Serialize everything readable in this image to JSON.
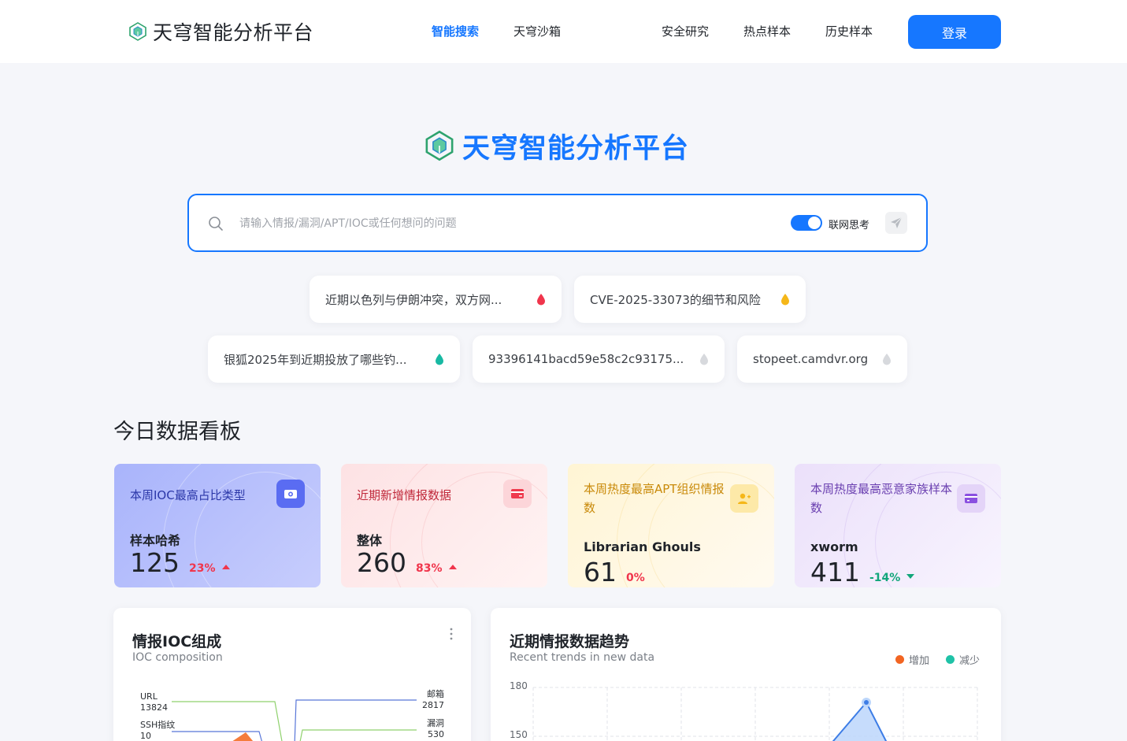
{
  "header": {
    "brand": "天穹智能分析平台",
    "nav": [
      {
        "label": "智能搜索",
        "active": true
      },
      {
        "label": "天穹沙箱",
        "active": false
      },
      {
        "label": "安全研究",
        "active": false
      },
      {
        "label": "热点样本",
        "active": false
      },
      {
        "label": "历史样本",
        "active": false
      }
    ],
    "login_label": "登录"
  },
  "hero": {
    "title": "天穹智能分析平台"
  },
  "search": {
    "placeholder": "请输入情报/漏洞/APT/IOC或任何想问的问题",
    "value": "",
    "toggle_label": "联网思考",
    "toggle_on": true
  },
  "suggestions": [
    {
      "text": "近期以色列与伊朗冲突，双方网...",
      "icon": "drop-icon",
      "color": "#f0354c"
    },
    {
      "text": "CVE-2025-33073的细节和风险",
      "icon": "drop-icon",
      "color": "#f5b719"
    },
    {
      "text": "银狐2025年到近期投放了哪些钓...",
      "icon": "drop-icon",
      "color": "#18b9a3"
    },
    {
      "text": "93396141bacd59e58c2c93175...",
      "icon": "drop-icon",
      "color": "#d7d9dd"
    },
    {
      "text": "stopeet.camdvr.org",
      "icon": "drop-icon",
      "color": "#d7d9dd"
    }
  ],
  "dashboard": {
    "title": "今日数据看板",
    "cards": [
      {
        "title": "本周IOC最高占比类型",
        "sub": "样本哈希",
        "value": "125",
        "delta": "23%",
        "trend": "up",
        "icon": "camera-icon"
      },
      {
        "title": "近期新增情报数据",
        "sub": "整体",
        "value": "260",
        "delta": "83%",
        "trend": "up",
        "icon": "card-icon"
      },
      {
        "title": "本周热度最高APT组织情报数",
        "sub": "Librarian Ghouls",
        "value": "61",
        "delta": "0%",
        "trend": "none",
        "icon": "user-add-icon"
      },
      {
        "title": "本周热度最高恶意家族样本数",
        "sub": "xworm",
        "value": "411",
        "delta": "-14%",
        "trend": "down",
        "icon": "wallet-icon"
      }
    ]
  },
  "ioc_panel": {
    "title": "情报IOC组成",
    "subtitle": "IOC composition",
    "left_labels": [
      {
        "name": "URL",
        "value": "13824"
      },
      {
        "name": "SSH指纹",
        "value": "10"
      }
    ],
    "right_labels": [
      {
        "name": "邮箱",
        "value": "2817"
      },
      {
        "name": "漏洞",
        "value": "530"
      }
    ]
  },
  "trend_panel": {
    "title": "近期情报数据趋势",
    "subtitle": "Recent trends in new data",
    "legend": [
      {
        "label": "增加",
        "color": "#f26522"
      },
      {
        "label": "减少",
        "color": "#1fc2a7"
      }
    ]
  },
  "chart_data": {
    "type": "area",
    "y_ticks": [
      180,
      150
    ],
    "ylim": [
      150,
      180
    ],
    "series": [
      {
        "name": "增加",
        "color": "#f26522"
      },
      {
        "name": "减少",
        "color": "#1fc2a7"
      }
    ],
    "grid": true,
    "legend_position": "top-right"
  }
}
